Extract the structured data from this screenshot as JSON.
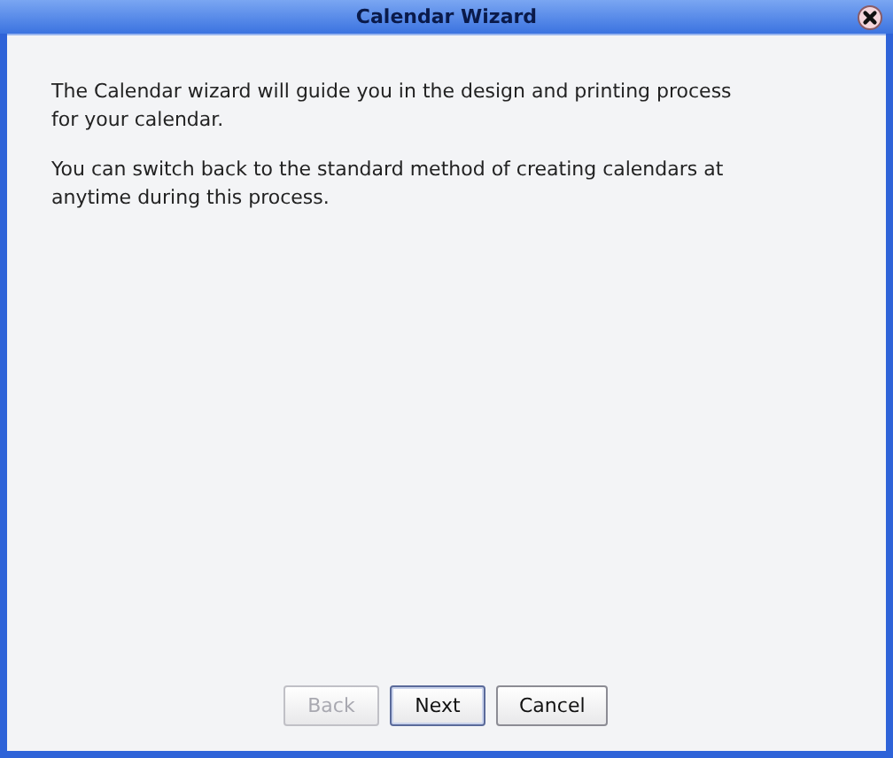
{
  "window": {
    "title": "Calendar Wizard"
  },
  "paragraphs": [
    "The Calendar wizard will guide you in the design and printing process for your calendar.",
    "You can switch back to the standard method of creating calendars at anytime during this process."
  ],
  "buttons": [
    {
      "label": "Back",
      "disabled": true,
      "default": false
    },
    {
      "label": "Next",
      "disabled": false,
      "default": true
    },
    {
      "label": "Cancel",
      "disabled": false,
      "default": false
    }
  ]
}
